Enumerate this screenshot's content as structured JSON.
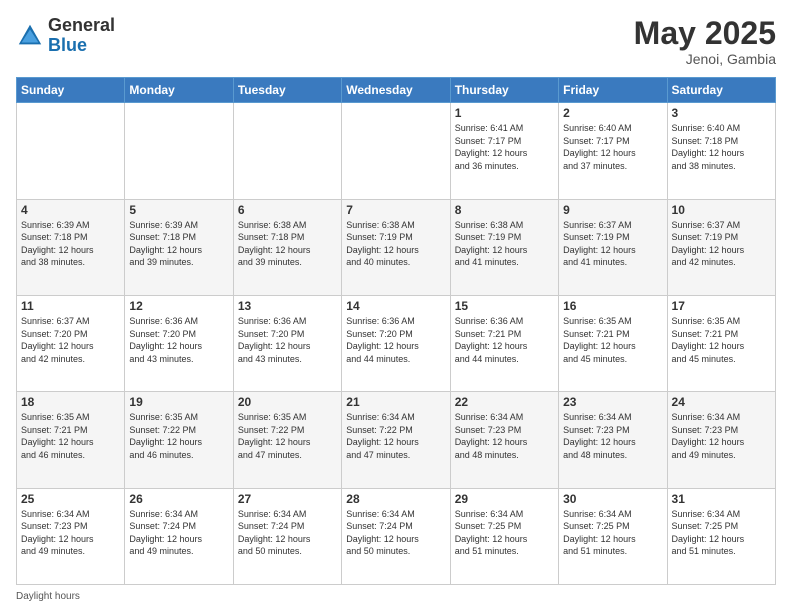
{
  "header": {
    "logo_general": "General",
    "logo_blue": "Blue",
    "title": "May 2025",
    "location": "Jenoi, Gambia"
  },
  "days_of_week": [
    "Sunday",
    "Monday",
    "Tuesday",
    "Wednesday",
    "Thursday",
    "Friday",
    "Saturday"
  ],
  "weeks": [
    [
      {
        "day": "",
        "info": ""
      },
      {
        "day": "",
        "info": ""
      },
      {
        "day": "",
        "info": ""
      },
      {
        "day": "",
        "info": ""
      },
      {
        "day": "1",
        "info": "Sunrise: 6:41 AM\nSunset: 7:17 PM\nDaylight: 12 hours\nand 36 minutes."
      },
      {
        "day": "2",
        "info": "Sunrise: 6:40 AM\nSunset: 7:17 PM\nDaylight: 12 hours\nand 37 minutes."
      },
      {
        "day": "3",
        "info": "Sunrise: 6:40 AM\nSunset: 7:18 PM\nDaylight: 12 hours\nand 38 minutes."
      }
    ],
    [
      {
        "day": "4",
        "info": "Sunrise: 6:39 AM\nSunset: 7:18 PM\nDaylight: 12 hours\nand 38 minutes."
      },
      {
        "day": "5",
        "info": "Sunrise: 6:39 AM\nSunset: 7:18 PM\nDaylight: 12 hours\nand 39 minutes."
      },
      {
        "day": "6",
        "info": "Sunrise: 6:38 AM\nSunset: 7:18 PM\nDaylight: 12 hours\nand 39 minutes."
      },
      {
        "day": "7",
        "info": "Sunrise: 6:38 AM\nSunset: 7:19 PM\nDaylight: 12 hours\nand 40 minutes."
      },
      {
        "day": "8",
        "info": "Sunrise: 6:38 AM\nSunset: 7:19 PM\nDaylight: 12 hours\nand 41 minutes."
      },
      {
        "day": "9",
        "info": "Sunrise: 6:37 AM\nSunset: 7:19 PM\nDaylight: 12 hours\nand 41 minutes."
      },
      {
        "day": "10",
        "info": "Sunrise: 6:37 AM\nSunset: 7:19 PM\nDaylight: 12 hours\nand 42 minutes."
      }
    ],
    [
      {
        "day": "11",
        "info": "Sunrise: 6:37 AM\nSunset: 7:20 PM\nDaylight: 12 hours\nand 42 minutes."
      },
      {
        "day": "12",
        "info": "Sunrise: 6:36 AM\nSunset: 7:20 PM\nDaylight: 12 hours\nand 43 minutes."
      },
      {
        "day": "13",
        "info": "Sunrise: 6:36 AM\nSunset: 7:20 PM\nDaylight: 12 hours\nand 43 minutes."
      },
      {
        "day": "14",
        "info": "Sunrise: 6:36 AM\nSunset: 7:20 PM\nDaylight: 12 hours\nand 44 minutes."
      },
      {
        "day": "15",
        "info": "Sunrise: 6:36 AM\nSunset: 7:21 PM\nDaylight: 12 hours\nand 44 minutes."
      },
      {
        "day": "16",
        "info": "Sunrise: 6:35 AM\nSunset: 7:21 PM\nDaylight: 12 hours\nand 45 minutes."
      },
      {
        "day": "17",
        "info": "Sunrise: 6:35 AM\nSunset: 7:21 PM\nDaylight: 12 hours\nand 45 minutes."
      }
    ],
    [
      {
        "day": "18",
        "info": "Sunrise: 6:35 AM\nSunset: 7:21 PM\nDaylight: 12 hours\nand 46 minutes."
      },
      {
        "day": "19",
        "info": "Sunrise: 6:35 AM\nSunset: 7:22 PM\nDaylight: 12 hours\nand 46 minutes."
      },
      {
        "day": "20",
        "info": "Sunrise: 6:35 AM\nSunset: 7:22 PM\nDaylight: 12 hours\nand 47 minutes."
      },
      {
        "day": "21",
        "info": "Sunrise: 6:34 AM\nSunset: 7:22 PM\nDaylight: 12 hours\nand 47 minutes."
      },
      {
        "day": "22",
        "info": "Sunrise: 6:34 AM\nSunset: 7:23 PM\nDaylight: 12 hours\nand 48 minutes."
      },
      {
        "day": "23",
        "info": "Sunrise: 6:34 AM\nSunset: 7:23 PM\nDaylight: 12 hours\nand 48 minutes."
      },
      {
        "day": "24",
        "info": "Sunrise: 6:34 AM\nSunset: 7:23 PM\nDaylight: 12 hours\nand 49 minutes."
      }
    ],
    [
      {
        "day": "25",
        "info": "Sunrise: 6:34 AM\nSunset: 7:23 PM\nDaylight: 12 hours\nand 49 minutes."
      },
      {
        "day": "26",
        "info": "Sunrise: 6:34 AM\nSunset: 7:24 PM\nDaylight: 12 hours\nand 49 minutes."
      },
      {
        "day": "27",
        "info": "Sunrise: 6:34 AM\nSunset: 7:24 PM\nDaylight: 12 hours\nand 50 minutes."
      },
      {
        "day": "28",
        "info": "Sunrise: 6:34 AM\nSunset: 7:24 PM\nDaylight: 12 hours\nand 50 minutes."
      },
      {
        "day": "29",
        "info": "Sunrise: 6:34 AM\nSunset: 7:25 PM\nDaylight: 12 hours\nand 51 minutes."
      },
      {
        "day": "30",
        "info": "Sunrise: 6:34 AM\nSunset: 7:25 PM\nDaylight: 12 hours\nand 51 minutes."
      },
      {
        "day": "31",
        "info": "Sunrise: 6:34 AM\nSunset: 7:25 PM\nDaylight: 12 hours\nand 51 minutes."
      }
    ]
  ],
  "footer": "Daylight hours"
}
